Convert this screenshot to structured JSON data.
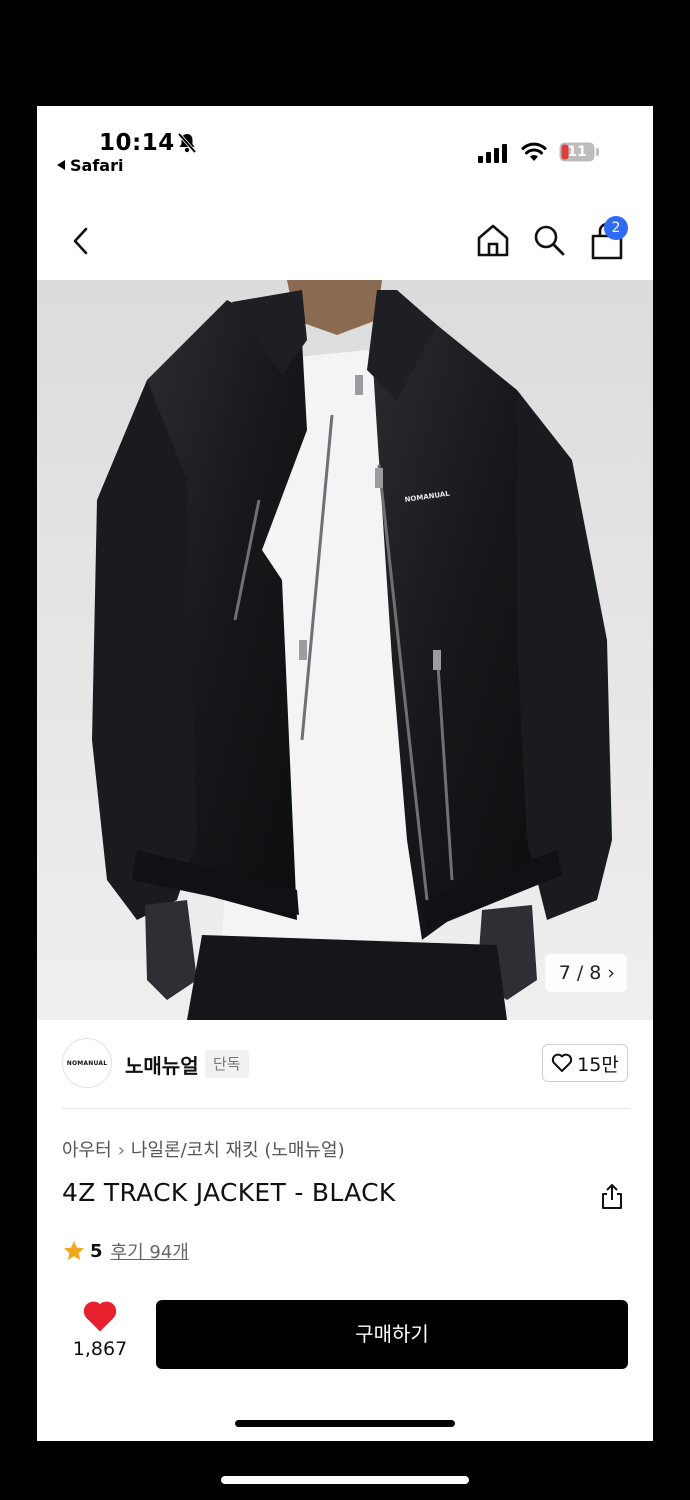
{
  "status_bar": {
    "time": "10:14",
    "back_app": "Safari",
    "battery": "11"
  },
  "nav": {
    "cart_count": "2"
  },
  "gallery": {
    "counter": "7 / 8 ›",
    "logo_text": "NOMANUAL"
  },
  "brand": {
    "logo_text": "NOMANUAL",
    "name": "노매뉴얼",
    "tag": "단독",
    "likes": "15만"
  },
  "breadcrumb": {
    "category": "아우터",
    "subcategory": "나일론/코치 재킷 (노매뉴얼)"
  },
  "product": {
    "title": "4Z TRACK JACKET - BLACK",
    "rating": "5",
    "reviews": "후기 94개"
  },
  "bottom_bar": {
    "like_count": "1,867",
    "buy_label": "구매하기"
  },
  "colors": {
    "badge": "#2f6bf2",
    "heart": "#e8212e",
    "star": "#f2a81d",
    "button": "#000000"
  }
}
